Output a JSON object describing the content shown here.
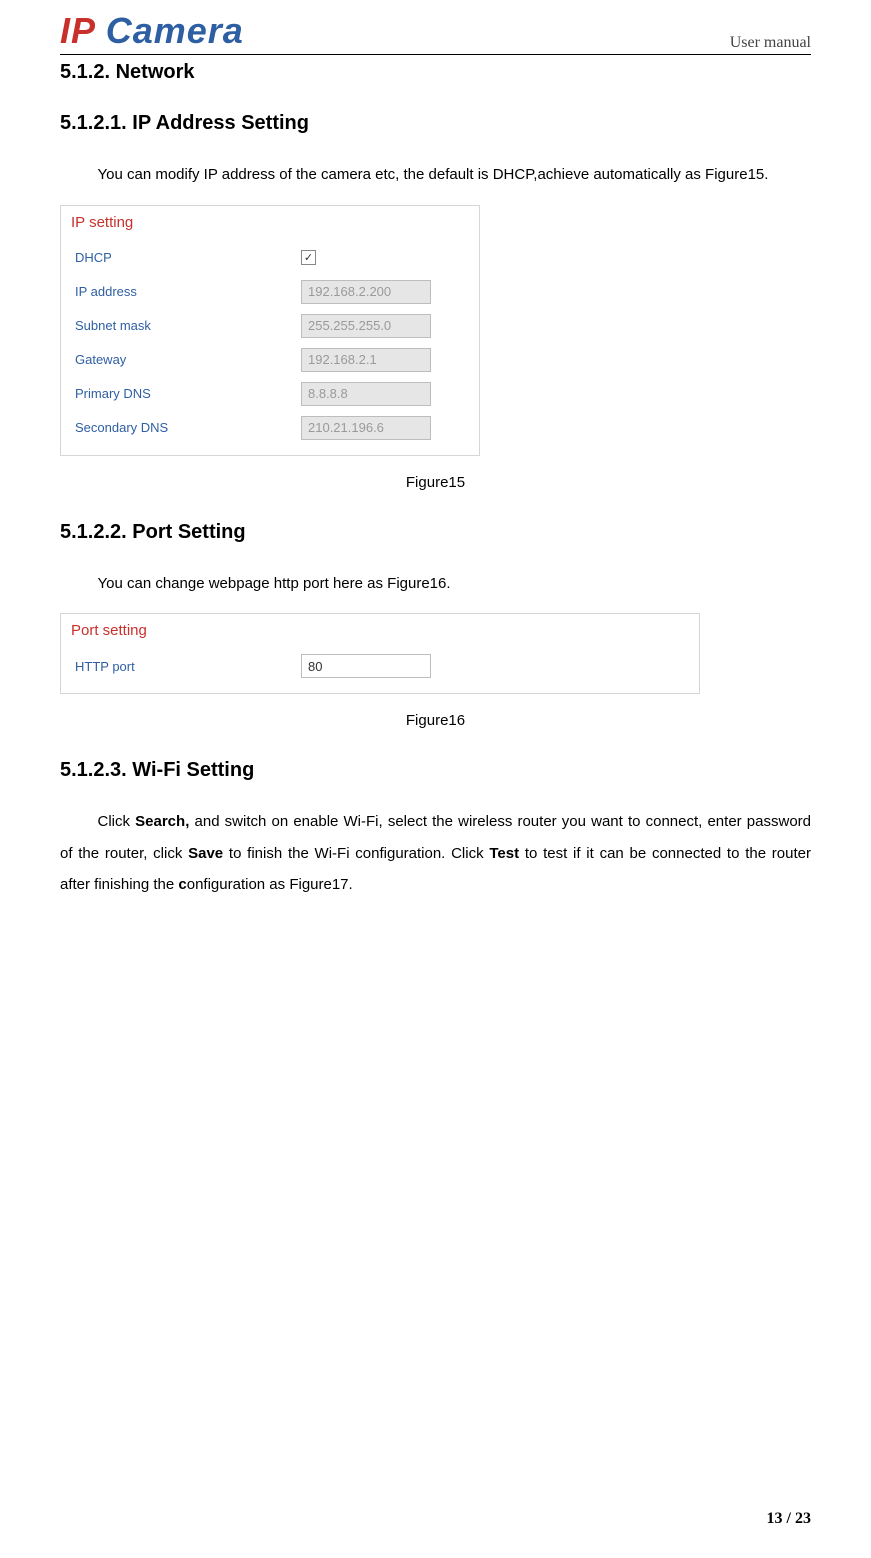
{
  "header": {
    "logo_ip": "IP",
    "logo_camera": " Camera",
    "right": "User manual"
  },
  "s1": {
    "heading": "5.1.2.  Network",
    "sub1": "5.1.2.1. IP Address Setting",
    "p1": "You can modify IP address of the camera etc, the default is DHCP,achieve automatically as Figure15.",
    "panel_title": "IP setting",
    "rows": {
      "dhcp": "DHCP",
      "ip": "IP address",
      "subnet": "Subnet mask",
      "gateway": "Gateway",
      "pdns": "Primary DNS",
      "sdns": "Secondary DNS"
    },
    "values": {
      "ip": "192.168.2.200",
      "subnet": "255.255.255.0",
      "gateway": "192.168.2.1",
      "pdns": "8.8.8.8",
      "sdns": "210.21.196.6"
    },
    "caption": "Figure15"
  },
  "s2": {
    "heading": "5.1.2.2. Port Setting",
    "p1": "You can change webpage http port here as Figure16.",
    "panel_title": "Port setting",
    "row_label": "HTTP port",
    "row_value": "80",
    "caption": "Figure16"
  },
  "s3": {
    "heading": "5.1.2.3. Wi-Fi Setting",
    "p_pre": "Click ",
    "b1": "Search,",
    "p_mid1": " and switch on enable Wi-Fi, select the wireless router you want to connect, enter password of the router, click ",
    "b2": "Save",
    "p_mid2": " to finish the Wi-Fi configuration. Click ",
    "b3": "Test",
    "p_mid3": " to test if it can be connected to the router after finishing the ",
    "b4": "c",
    "p_end": "onfiguration as Figure17."
  },
  "footer": "13 / 23"
}
